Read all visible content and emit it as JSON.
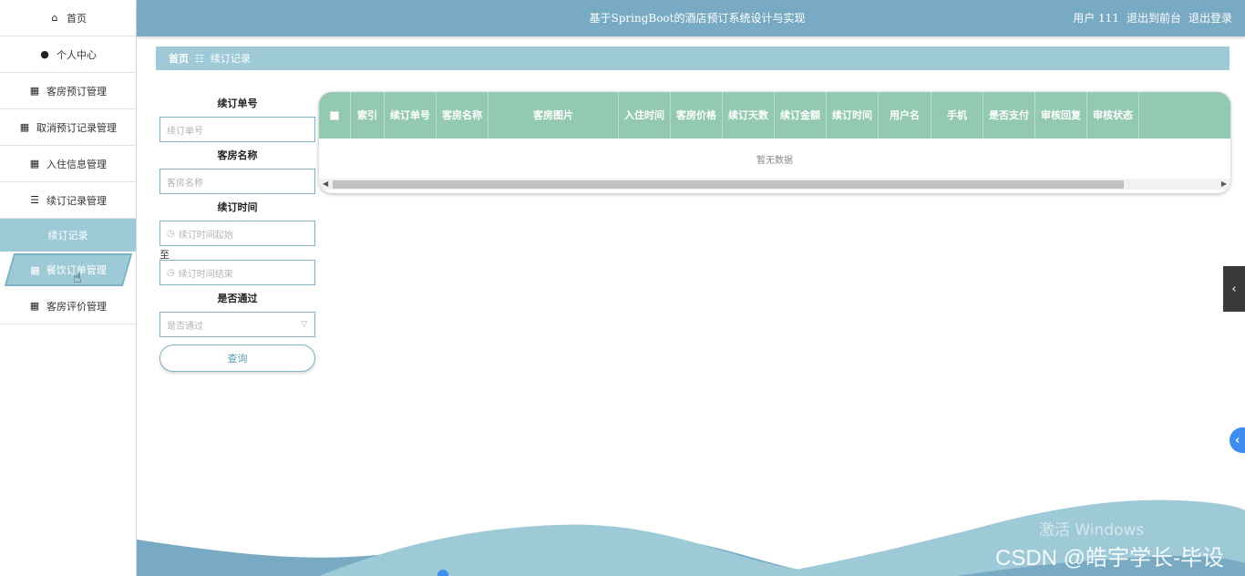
{
  "app": {
    "title": "基于SpringBoot的酒店预订系统设计与实现",
    "user_label": "用户 111",
    "to_front_label": "退出到前台",
    "logout_label": "退出登录"
  },
  "sidebar": {
    "items": [
      {
        "label": "首页",
        "icon": "home-icon"
      },
      {
        "label": "个人中心",
        "icon": "user-icon"
      },
      {
        "label": "客房预订管理",
        "icon": "grid-icon"
      },
      {
        "label": "取消预订记录管理",
        "icon": "grid-icon"
      },
      {
        "label": "入住信息管理",
        "icon": "grid-icon"
      },
      {
        "label": "续订记录管理",
        "icon": "list-icon"
      }
    ],
    "submenu_label": "续订记录",
    "active_label": "餐饮订单管理",
    "last_label": "客房评价管理"
  },
  "breadcrumb": {
    "home": "首页",
    "current": "续订记录"
  },
  "filters": {
    "order_no_label": "续订单号",
    "order_no_placeholder": "续订单号",
    "room_name_label": "客房名称",
    "room_name_placeholder": "客房名称",
    "time_label": "续订时间",
    "time_start_placeholder": "续订时间起始",
    "to_label": "至",
    "time_end_placeholder": "续订时间结束",
    "passed_label": "是否通过",
    "passed_placeholder": "是否通过",
    "query_label": "查询"
  },
  "table": {
    "columns": [
      "索引",
      "续订单号",
      "客房名称",
      "客房图片",
      "入住时间",
      "客房价格",
      "续订天数",
      "续订金额",
      "续订时间",
      "用户名",
      "手机",
      "是否支付",
      "审核回复",
      "审核状态"
    ],
    "empty_text": "暂无数据"
  },
  "watermarks": {
    "windows": "激活 Windows",
    "csdn": "CSDN @皓宇学长-毕设"
  },
  "colors": {
    "header": "#78aac3",
    "accent": "#9ecad8",
    "table_header": "#93c8b1"
  }
}
